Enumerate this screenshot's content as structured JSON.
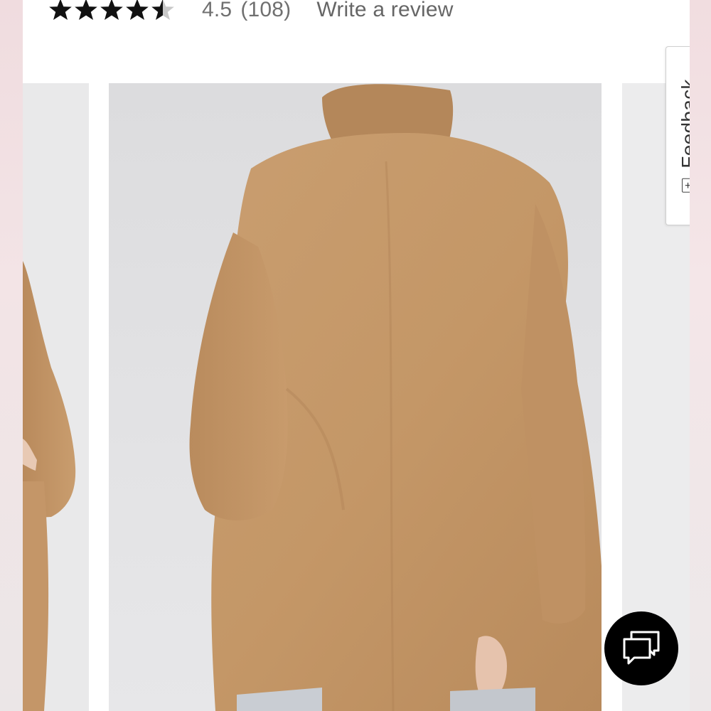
{
  "rating": {
    "stars_filled": 4.5,
    "stars_total": 5,
    "value": "4.5",
    "count": "(108)",
    "review_link": "Write a review"
  },
  "gallery": {
    "main_image": "tan-faux-fur-coat-back-view",
    "prev_image": "tan-faux-fur-coat-front-partial",
    "next_image": "next-product-image-partial"
  },
  "feedback_tab": {
    "icon": "plus-box-icon",
    "icon_glyph": "+",
    "label": "Feedback"
  },
  "chat": {
    "icon": "chat-bubbles-icon"
  },
  "colors": {
    "star": "#111111",
    "star_empty": "#c8c8c8",
    "text_muted": "#707070",
    "coat": "#c69b6d",
    "chat_bg": "#000000"
  }
}
